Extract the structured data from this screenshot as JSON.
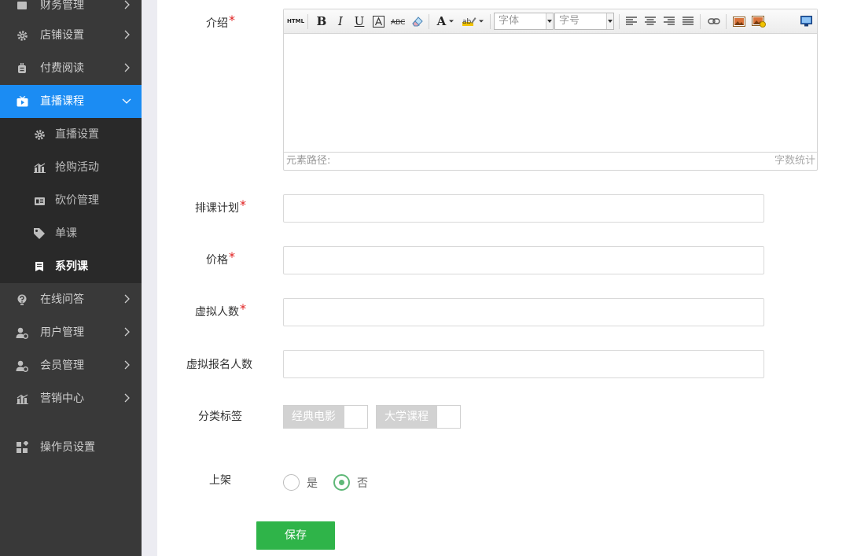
{
  "sidebar": {
    "items": [
      {
        "label": "财务管理",
        "icon": "finance-icon"
      },
      {
        "label": "店铺设置",
        "icon": "gear-icon"
      },
      {
        "label": "付费阅读",
        "icon": "pay-read-icon"
      },
      {
        "label": "直播课程",
        "icon": "live-icon"
      },
      {
        "label": "在线问答",
        "icon": "question-icon"
      },
      {
        "label": "用户管理",
        "icon": "user-icon"
      },
      {
        "label": "会员管理",
        "icon": "member-icon"
      },
      {
        "label": "营销中心",
        "icon": "chart-icon"
      },
      {
        "label": "操作员设置",
        "icon": "operator-icon"
      }
    ],
    "sub_items": [
      {
        "label": "直播设置",
        "icon": "gear-icon"
      },
      {
        "label": "抢购活动",
        "icon": "chart-icon"
      },
      {
        "label": "砍价管理",
        "icon": "bargain-icon"
      },
      {
        "label": "单课",
        "icon": "tag-icon"
      },
      {
        "label": "系列课",
        "icon": "book-icon"
      }
    ],
    "accent": "#1b8cf3"
  },
  "form": {
    "intro_label": "介绍",
    "schedule_label": "排课计划",
    "price_label": "价格",
    "virtual_count_label": "虚拟人数",
    "virtual_signup_label": "虚拟报名人数",
    "tags_label": "分类标签",
    "shelf_label": "上架",
    "required_mark": "*",
    "required_color": "#e02020"
  },
  "editor": {
    "toolbar": {
      "html_label": "HTML",
      "bold_label": "B",
      "italic_label": "I",
      "underline_label": "U",
      "font_color_label": "A",
      "font_family_placeholder": "字体",
      "font_size_placeholder": "字号"
    },
    "footer_path_label": "元素路径:",
    "footer_count_label": "字数统计"
  },
  "tags": [
    {
      "label": "经典电影"
    },
    {
      "label": "大学课程"
    }
  ],
  "shelf": {
    "options": [
      "是",
      "否"
    ],
    "selected": "否",
    "color": "#5fb878"
  },
  "save_label": "保存",
  "save_color": "#2fb449"
}
